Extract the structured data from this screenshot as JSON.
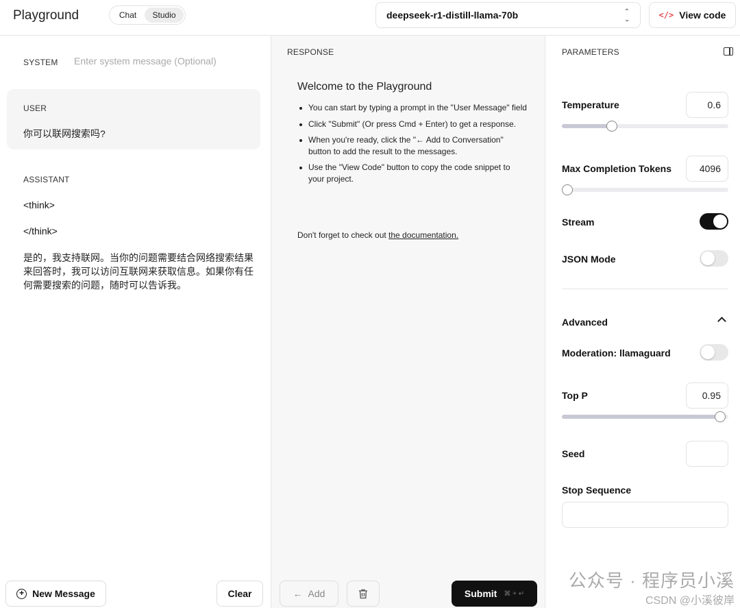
{
  "header": {
    "title": "Playground",
    "modes": [
      "Chat",
      "Studio"
    ],
    "selected_mode": "Studio",
    "model": "deepseek-r1-distill-llama-70b",
    "view_code_label": "View code"
  },
  "left": {
    "system_label": "SYSTEM",
    "system_placeholder": "Enter system message (Optional)",
    "user_label": "USER",
    "user_message": "你可以联网搜索吗?",
    "assistant_label": "ASSISTANT",
    "think_open": "<think>",
    "think_close": "</think>",
    "assistant_message": "是的，我支持联网。当你的问题需要结合网络搜索结果来回答时，我可以访问互联网来获取信息。如果你有任何需要搜索的问题，随时可以告诉我。",
    "new_message_label": "New Message",
    "clear_label": "Clear"
  },
  "response": {
    "label": "RESPONSE",
    "welcome_title": "Welcome to the Playground",
    "bullets": [
      "You can start by typing a prompt in the \"User Message\" field",
      "Click \"Submit\" (Or press Cmd + Enter) to get a response.",
      "When you're ready, click the \"← Add to Conversation\" button to add the result to the messages.",
      "Use the \"View Code\" button to copy the code snippet to your project."
    ],
    "doc_note_prefix": "Don't forget to check out ",
    "doc_link": "the documentation.",
    "add_label": "Add",
    "submit_label": "Submit",
    "submit_hint": "⌘ + ↵"
  },
  "parameters": {
    "label": "PARAMETERS",
    "temperature": {
      "name": "Temperature",
      "value": "0.6",
      "fraction": 0.3
    },
    "max_tokens": {
      "name": "Max Completion Tokens",
      "value": "4096",
      "fraction": 0.02
    },
    "stream": {
      "name": "Stream",
      "on": true
    },
    "json_mode": {
      "name": "JSON Mode",
      "on": false
    },
    "advanced_label": "Advanced",
    "moderation": {
      "name": "Moderation: llamaguard",
      "on": false
    },
    "top_p": {
      "name": "Top P",
      "value": "0.95",
      "fraction": 0.95
    },
    "seed": {
      "name": "Seed",
      "value": ""
    },
    "stop_sequence": {
      "name": "Stop Sequence",
      "value": ""
    }
  },
  "watermark": {
    "line1": "公众号 · 程序员小溪",
    "line2": "CSDN @小溪彼岸"
  }
}
